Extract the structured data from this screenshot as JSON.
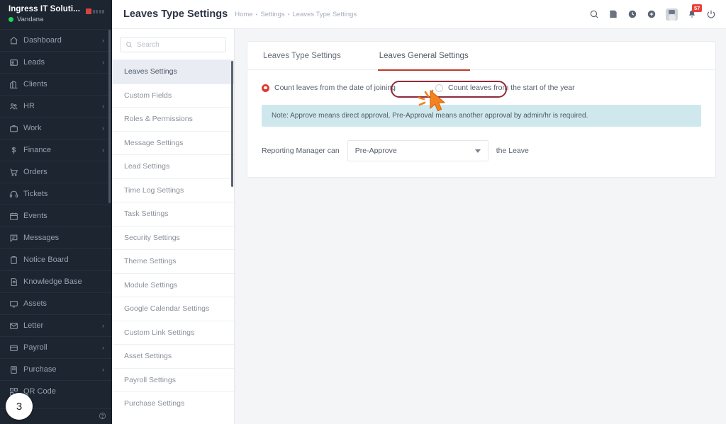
{
  "sidebar": {
    "company": "Ingress IT Soluti...",
    "user": "Vandana",
    "status_color": "#1fd655",
    "items": [
      {
        "label": "Dashboard",
        "icon": "home-icon",
        "arrow": "›"
      },
      {
        "label": "Leads",
        "icon": "leads-icon",
        "arrow": "›"
      },
      {
        "label": "Clients",
        "icon": "clients-icon",
        "arrow": ""
      },
      {
        "label": "HR",
        "icon": "hr-icon",
        "arrow": "›"
      },
      {
        "label": "Work",
        "icon": "briefcase-icon",
        "arrow": "›"
      },
      {
        "label": "Finance",
        "icon": "dollar-icon",
        "arrow": "›"
      },
      {
        "label": "Orders",
        "icon": "cart-icon",
        "arrow": ""
      },
      {
        "label": "Tickets",
        "icon": "headset-icon",
        "arrow": ""
      },
      {
        "label": "Events",
        "icon": "calendar-icon",
        "arrow": ""
      },
      {
        "label": "Messages",
        "icon": "message-icon",
        "arrow": ""
      },
      {
        "label": "Notice Board",
        "icon": "clipboard-icon",
        "arrow": ""
      },
      {
        "label": "Knowledge Base",
        "icon": "book-icon",
        "arrow": ""
      },
      {
        "label": "Assets",
        "icon": "monitor-icon",
        "arrow": ""
      },
      {
        "label": "Letter",
        "icon": "envelope-icon",
        "arrow": "›"
      },
      {
        "label": "Payroll",
        "icon": "wallet-icon",
        "arrow": "›"
      },
      {
        "label": "Purchase",
        "icon": "purchase-icon",
        "arrow": "›"
      },
      {
        "label": "QR Code",
        "icon": "qr-icon",
        "arrow": ""
      }
    ],
    "help_icon": "help-icon",
    "step_badge": "3"
  },
  "header": {
    "title": "Leaves Type Settings",
    "breadcrumbs": [
      "Home",
      "Settings",
      "Leaves Type Settings"
    ],
    "separator": "•",
    "icons": [
      "search-icon",
      "note-icon",
      "clock-icon",
      "plus-circle-icon",
      "avatar",
      "bell-icon",
      "power-icon"
    ],
    "notification_count": "57",
    "notification_color": "#e8413c"
  },
  "settings_nav": {
    "search_placeholder": "Search",
    "search_value": "",
    "search_icon": "search-icon",
    "items": [
      {
        "label": "Leaves Settings",
        "active": true
      },
      {
        "label": "Custom Fields",
        "active": false
      },
      {
        "label": "Roles & Permissions",
        "active": false
      },
      {
        "label": "Message Settings",
        "active": false
      },
      {
        "label": "Lead Settings",
        "active": false
      },
      {
        "label": "Time Log Settings",
        "active": false
      },
      {
        "label": "Task Settings",
        "active": false
      },
      {
        "label": "Security Settings",
        "active": false
      },
      {
        "label": "Theme Settings",
        "active": false
      },
      {
        "label": "Module Settings",
        "active": false
      },
      {
        "label": "Google Calendar Settings",
        "active": false
      },
      {
        "label": "Custom Link Settings",
        "active": false
      },
      {
        "label": "Asset Settings",
        "active": false
      },
      {
        "label": "Payroll Settings",
        "active": false
      },
      {
        "label": "Purchase Settings",
        "active": false
      }
    ]
  },
  "content": {
    "tabs": [
      {
        "label": "Leaves Type Settings",
        "active": false
      },
      {
        "label": "Leaves General Settings",
        "active": true
      }
    ],
    "active_tab_color": "#c0392b",
    "radio_options": [
      {
        "label": "Count leaves from the date of joining",
        "selected": true
      },
      {
        "label": "Count leaves from the start of the year",
        "selected": false
      }
    ],
    "radio_selected_color": "#e03b33",
    "highlight_color": "#8e2b3a",
    "note": "Note: Approve means direct approval, Pre-Approval means another approval by admin/hr is required.",
    "note_bg": "#cfe8ee",
    "manager_label": "Reporting Manager can",
    "manager_value": "Pre-Approve",
    "manager_suffix": "the Leave"
  }
}
